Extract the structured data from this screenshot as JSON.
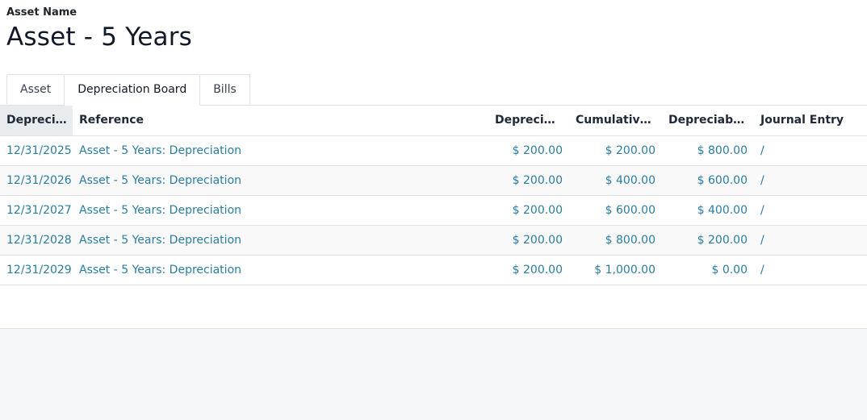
{
  "asset": {
    "label": "Asset Name",
    "title": "Asset - 5 Years"
  },
  "tabs": [
    {
      "label": "Asset",
      "active": false
    },
    {
      "label": "Depreciation Board",
      "active": true
    },
    {
      "label": "Bills",
      "active": false
    }
  ],
  "table": {
    "sort_icon": "chevron-up-icon",
    "headers": {
      "date": "Depreci...",
      "reference": "Reference",
      "depreciation": "Depreciation",
      "cumulative": "Cumulative D...",
      "depreciable": "Depreciable ...",
      "journal": "Journal Entry"
    },
    "rows": [
      {
        "date": "12/31/2025",
        "reference": "Asset - 5 Years: Depreciation",
        "depreciation": "$ 200.00",
        "cumulative": "$ 200.00",
        "depreciable": "$ 800.00",
        "journal": "/"
      },
      {
        "date": "12/31/2026",
        "reference": "Asset - 5 Years: Depreciation",
        "depreciation": "$ 200.00",
        "cumulative": "$ 400.00",
        "depreciable": "$ 600.00",
        "journal": "/"
      },
      {
        "date": "12/31/2027",
        "reference": "Asset - 5 Years: Depreciation",
        "depreciation": "$ 200.00",
        "cumulative": "$ 600.00",
        "depreciable": "$ 400.00",
        "journal": "/"
      },
      {
        "date": "12/31/2028",
        "reference": "Asset - 5 Years: Depreciation",
        "depreciation": "$ 200.00",
        "cumulative": "$ 800.00",
        "depreciable": "$ 200.00",
        "journal": "/"
      },
      {
        "date": "12/31/2029",
        "reference": "Asset - 5 Years: Depreciation",
        "depreciation": "$ 200.00",
        "cumulative": "$ 1,000.00",
        "depreciable": "$ 0.00",
        "journal": "/"
      }
    ]
  },
  "colors": {
    "link": "#2a7d9f",
    "border": "#dee2e6",
    "sorted_header_bg": "#e9ecef",
    "footer_bg": "#f6f7f9"
  }
}
